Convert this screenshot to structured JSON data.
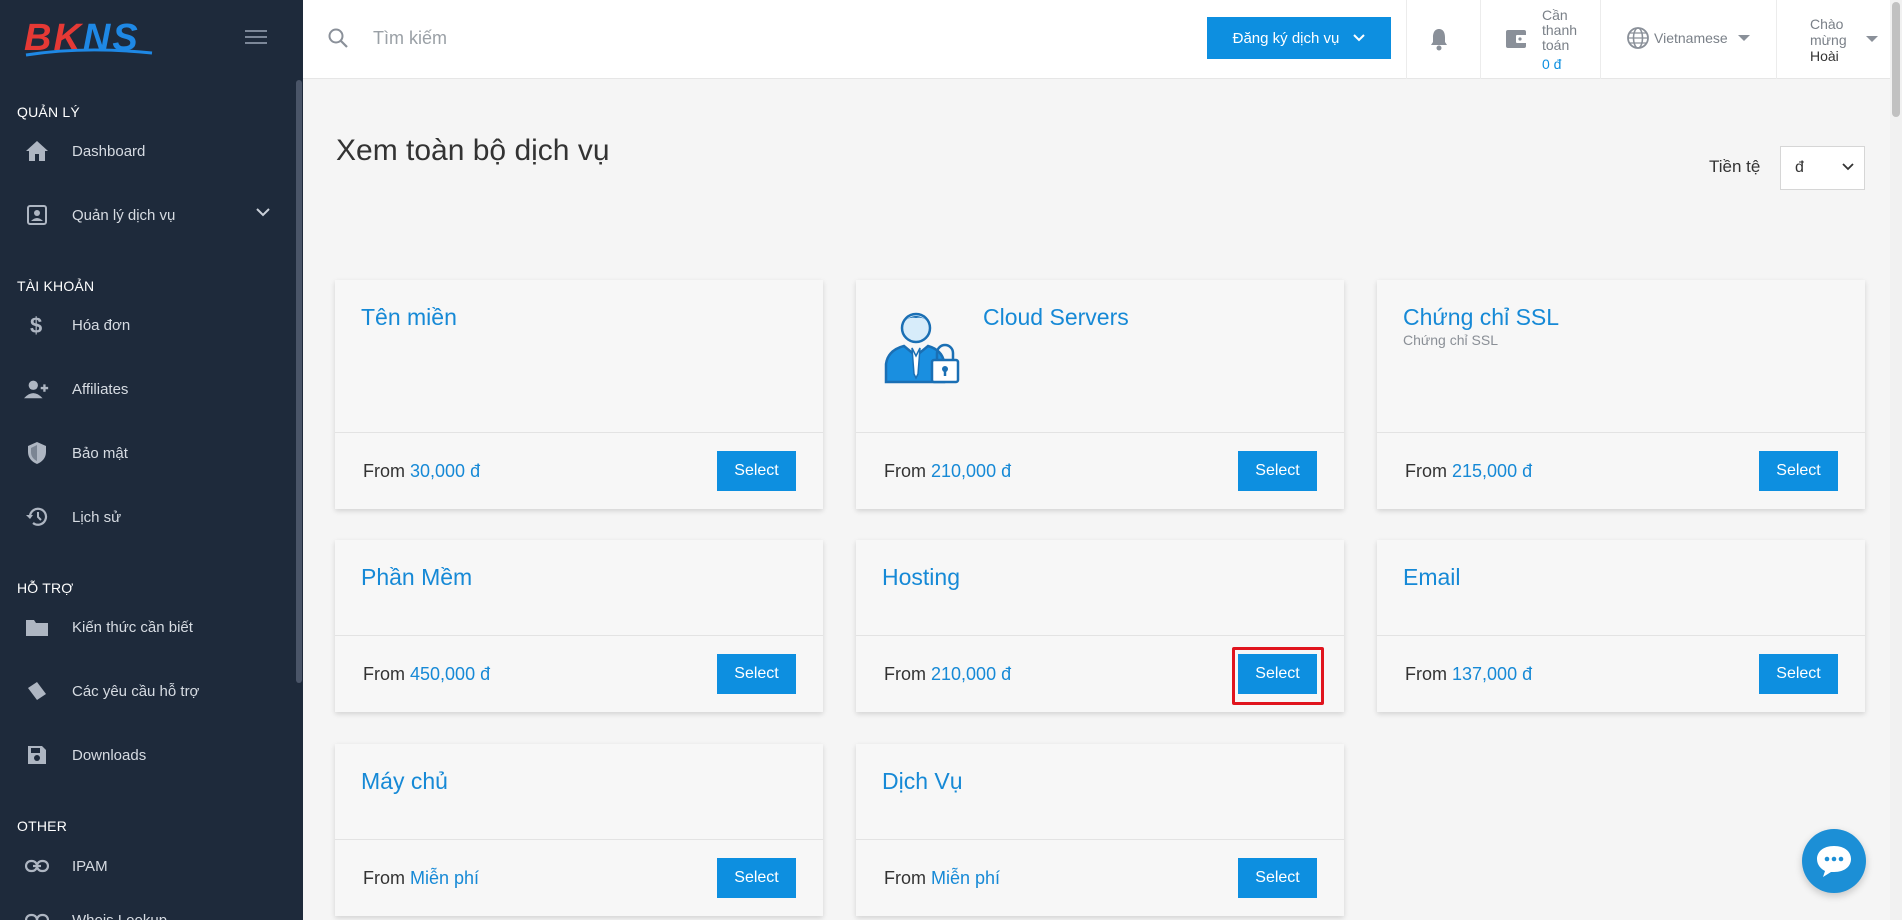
{
  "brand": {
    "logo_left": "BK",
    "logo_right": "NS"
  },
  "sidebar": {
    "sections": [
      {
        "title": "QUẢN LÝ"
      },
      {
        "title": "TÀI KHOẢN"
      },
      {
        "title": "HỖ TRỢ"
      },
      {
        "title": "OTHER"
      }
    ],
    "items": [
      {
        "label": "Dashboard",
        "icon": "home-icon"
      },
      {
        "label": "Quản lý dịch vụ",
        "icon": "account-box-icon"
      },
      {
        "label": "Hóa đơn",
        "icon": "dollar-icon"
      },
      {
        "label": "Affiliates",
        "icon": "users-icon"
      },
      {
        "label": "Bảo mật",
        "icon": "shield-icon"
      },
      {
        "label": "Lịch sử",
        "icon": "history-icon"
      },
      {
        "label": "Kiến thức cần biết",
        "icon": "folder-icon"
      },
      {
        "label": "Các yêu cầu hỗ trợ",
        "icon": "ticket-icon"
      },
      {
        "label": "Downloads",
        "icon": "save-icon"
      },
      {
        "label": "IPAM",
        "icon": "link-icon"
      },
      {
        "label": "Whois Lookup",
        "icon": "link-icon"
      }
    ]
  },
  "header": {
    "search_placeholder": "Tìm kiếm",
    "register_label": "Đăng ký dịch vụ",
    "pay_label_1": "Cần",
    "pay_label_2": "thanh",
    "pay_label_3": "toán",
    "pay_amount": "0 đ",
    "language": "Vietnamese",
    "welcome_1": "Chào",
    "welcome_2": "mừng",
    "user_name": "Hoài"
  },
  "main": {
    "title": "Xem toàn bộ dịch vụ",
    "currency_label": "Tiền tệ",
    "currency_value": "đ",
    "from_label": "From",
    "select_label": "Select",
    "cards": [
      {
        "title": "Tên miền",
        "subtitle": "",
        "price": "30,000 đ"
      },
      {
        "title": "Cloud Servers",
        "subtitle": "",
        "price": "210,000 đ"
      },
      {
        "title": "Chứng chỉ SSL",
        "subtitle": "Chứng chỉ SSL",
        "price": "215,000 đ"
      },
      {
        "title": "Phần Mềm",
        "subtitle": "",
        "price": "450,000 đ"
      },
      {
        "title": "Hosting",
        "subtitle": "",
        "price": "210,000 đ"
      },
      {
        "title": "Email",
        "subtitle": "",
        "price": "137,000 đ"
      },
      {
        "title": "Máy chủ",
        "subtitle": "",
        "price": "Miễn phí"
      },
      {
        "title": "Dịch Vụ",
        "subtitle": "",
        "price": "Miễn phí"
      }
    ]
  },
  "colors": {
    "accent": "#0d8fe0",
    "sidebar_bg": "#1e2a3b",
    "highlight": "#e0141e"
  }
}
